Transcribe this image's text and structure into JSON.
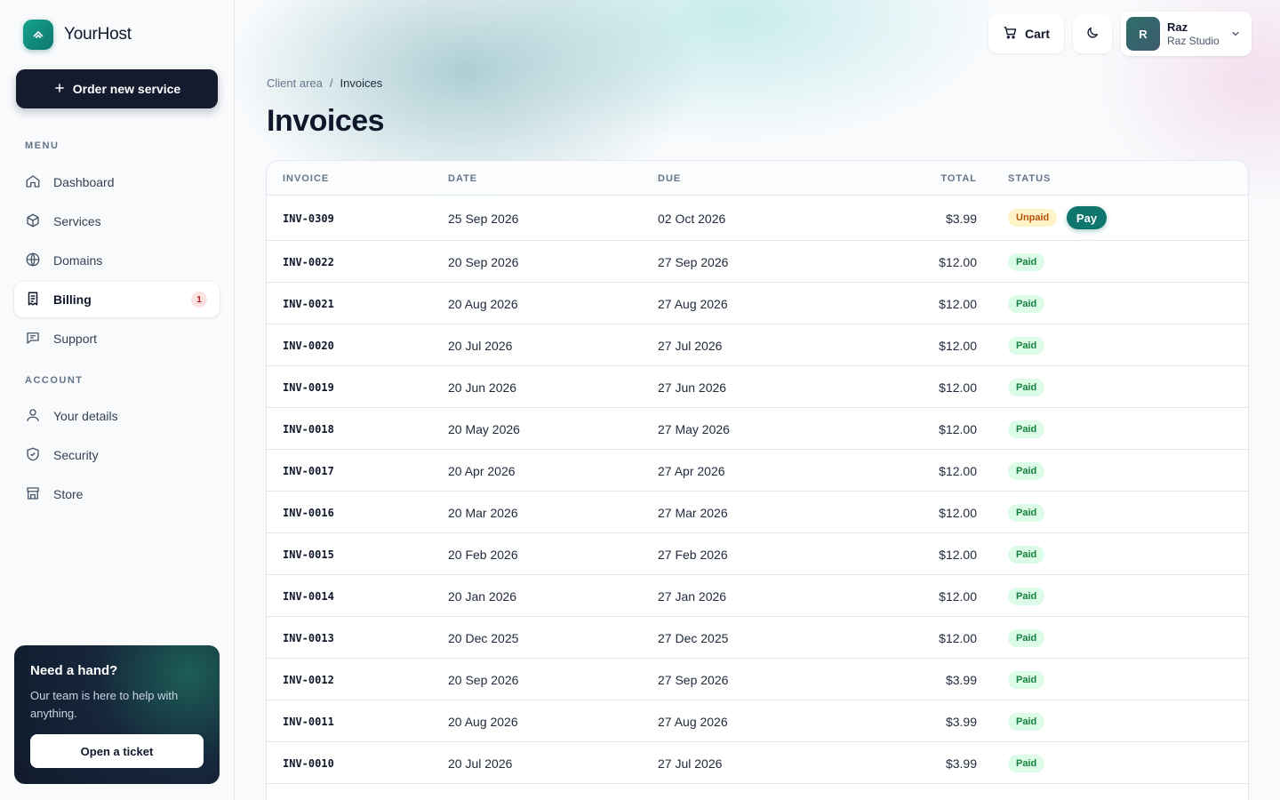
{
  "brand": {
    "name": "YourHost"
  },
  "sidebar": {
    "order_button": "Order new service",
    "menu_label": "MENU",
    "menu": [
      {
        "label": "Dashboard",
        "icon": "home-icon"
      },
      {
        "label": "Services",
        "icon": "box-icon"
      },
      {
        "label": "Domains",
        "icon": "globe-icon"
      },
      {
        "label": "Billing",
        "icon": "receipt-icon",
        "badge": "1",
        "active": true
      },
      {
        "label": "Support",
        "icon": "chat-icon"
      }
    ],
    "account_label": "ACCOUNT",
    "account": [
      {
        "label": "Your details",
        "icon": "user-icon"
      },
      {
        "label": "Security",
        "icon": "shield-icon"
      },
      {
        "label": "Store",
        "icon": "store-icon"
      }
    ],
    "help": {
      "title": "Need a hand?",
      "text": "Our team is here to help with anything.",
      "button": "Open a ticket"
    }
  },
  "topbar": {
    "cart_label": "Cart",
    "user": {
      "initial": "R",
      "name": "Raz",
      "org": "Raz Studio"
    }
  },
  "breadcrumb": {
    "root": "Client area",
    "separator": "/",
    "current": "Invoices"
  },
  "page_title": "Invoices",
  "table": {
    "headers": {
      "invoice": "INVOICE",
      "date": "DATE",
      "due": "DUE",
      "total": "TOTAL",
      "status": "STATUS"
    },
    "pay_label": "Pay",
    "rows": [
      {
        "invoice": "INV-0309",
        "date": "25 Sep 2026",
        "due": "02 Oct 2026",
        "total": "$3.99",
        "status": "Unpaid"
      },
      {
        "invoice": "INV-0022",
        "date": "20 Sep 2026",
        "due": "27 Sep 2026",
        "total": "$12.00",
        "status": "Paid"
      },
      {
        "invoice": "INV-0021",
        "date": "20 Aug 2026",
        "due": "27 Aug 2026",
        "total": "$12.00",
        "status": "Paid"
      },
      {
        "invoice": "INV-0020",
        "date": "20 Jul 2026",
        "due": "27 Jul 2026",
        "total": "$12.00",
        "status": "Paid"
      },
      {
        "invoice": "INV-0019",
        "date": "20 Jun 2026",
        "due": "27 Jun 2026",
        "total": "$12.00",
        "status": "Paid"
      },
      {
        "invoice": "INV-0018",
        "date": "20 May 2026",
        "due": "27 May 2026",
        "total": "$12.00",
        "status": "Paid"
      },
      {
        "invoice": "INV-0017",
        "date": "20 Apr 2026",
        "due": "27 Apr 2026",
        "total": "$12.00",
        "status": "Paid"
      },
      {
        "invoice": "INV-0016",
        "date": "20 Mar 2026",
        "due": "27 Mar 2026",
        "total": "$12.00",
        "status": "Paid"
      },
      {
        "invoice": "INV-0015",
        "date": "20 Feb 2026",
        "due": "27 Feb 2026",
        "total": "$12.00",
        "status": "Paid"
      },
      {
        "invoice": "INV-0014",
        "date": "20 Jan 2026",
        "due": "27 Jan 2026",
        "total": "$12.00",
        "status": "Paid"
      },
      {
        "invoice": "INV-0013",
        "date": "20 Dec 2025",
        "due": "27 Dec 2025",
        "total": "$12.00",
        "status": "Paid"
      },
      {
        "invoice": "INV-0012",
        "date": "20 Sep 2026",
        "due": "27 Sep 2026",
        "total": "$3.99",
        "status": "Paid"
      },
      {
        "invoice": "INV-0011",
        "date": "20 Aug 2026",
        "due": "27 Aug 2026",
        "total": "$3.99",
        "status": "Paid"
      },
      {
        "invoice": "INV-0010",
        "date": "20 Jul 2026",
        "due": "27 Jul 2026",
        "total": "$3.99",
        "status": "Paid"
      }
    ]
  }
}
